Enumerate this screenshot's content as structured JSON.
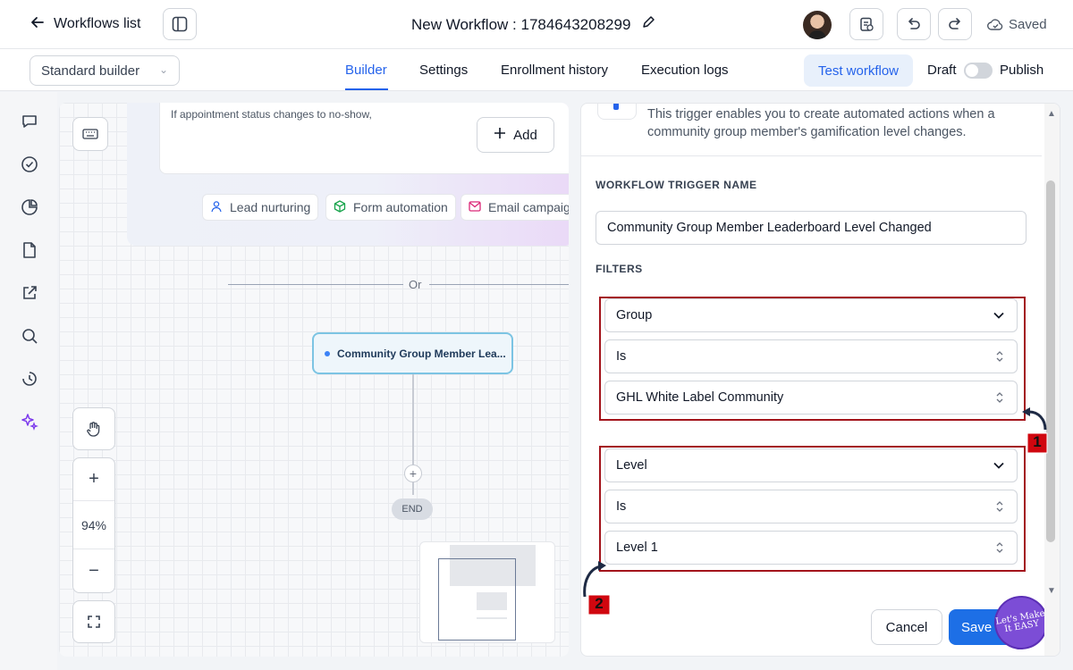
{
  "topbar": {
    "back_label": "Workflows list",
    "workflow_title": "New Workflow : 1784643208299",
    "saved_label": "Saved"
  },
  "subbar": {
    "builder_select": "Standard builder",
    "tabs": [
      {
        "label": "Builder",
        "active": true
      },
      {
        "label": "Settings",
        "active": false
      },
      {
        "label": "Enrollment history",
        "active": false
      },
      {
        "label": "Execution logs",
        "active": false
      }
    ],
    "test_workflow": "Test workflow",
    "draft": "Draft",
    "publish": "Publish",
    "accent": "#2563eb"
  },
  "rail": {
    "icons": [
      "chat-icon",
      "check-circle-icon",
      "pie-chart-icon",
      "document-icon",
      "external-link-icon",
      "search-icon",
      "history-icon",
      "sparkles-icon"
    ]
  },
  "canvas": {
    "trigger_hint": "If appointment status changes to no-show,",
    "add_label": "Add",
    "chips": [
      "Lead nurturing",
      "Form automation",
      "Email campaig"
    ],
    "or_label": "Or",
    "node_label": "Community Group Member Lea...",
    "end_label": "END",
    "zoom_in": "+",
    "zoom_level": "94%",
    "zoom_out": "−"
  },
  "panel": {
    "description": "This trigger enables you to create automated actions when a community group member's gamification level changes.",
    "trigger_name_label": "WORKFLOW TRIGGER NAME",
    "trigger_name_value": "Community Group Member Leaderboard Level Changed",
    "filters_label": "FILTERS",
    "filter_groups": [
      {
        "field": "Group",
        "operator": "Is",
        "value": "GHL White Label Community"
      },
      {
        "field": "Level",
        "operator": "Is",
        "value": "Level 1"
      }
    ],
    "cancel_label": "Cancel",
    "save_label": "Save",
    "badge_text": "Let's Make It EASY"
  },
  "annotations": {
    "marker_1": "1",
    "marker_2": "2",
    "highlight_color": "#a3141b",
    "marker_color": "#d0070f"
  }
}
